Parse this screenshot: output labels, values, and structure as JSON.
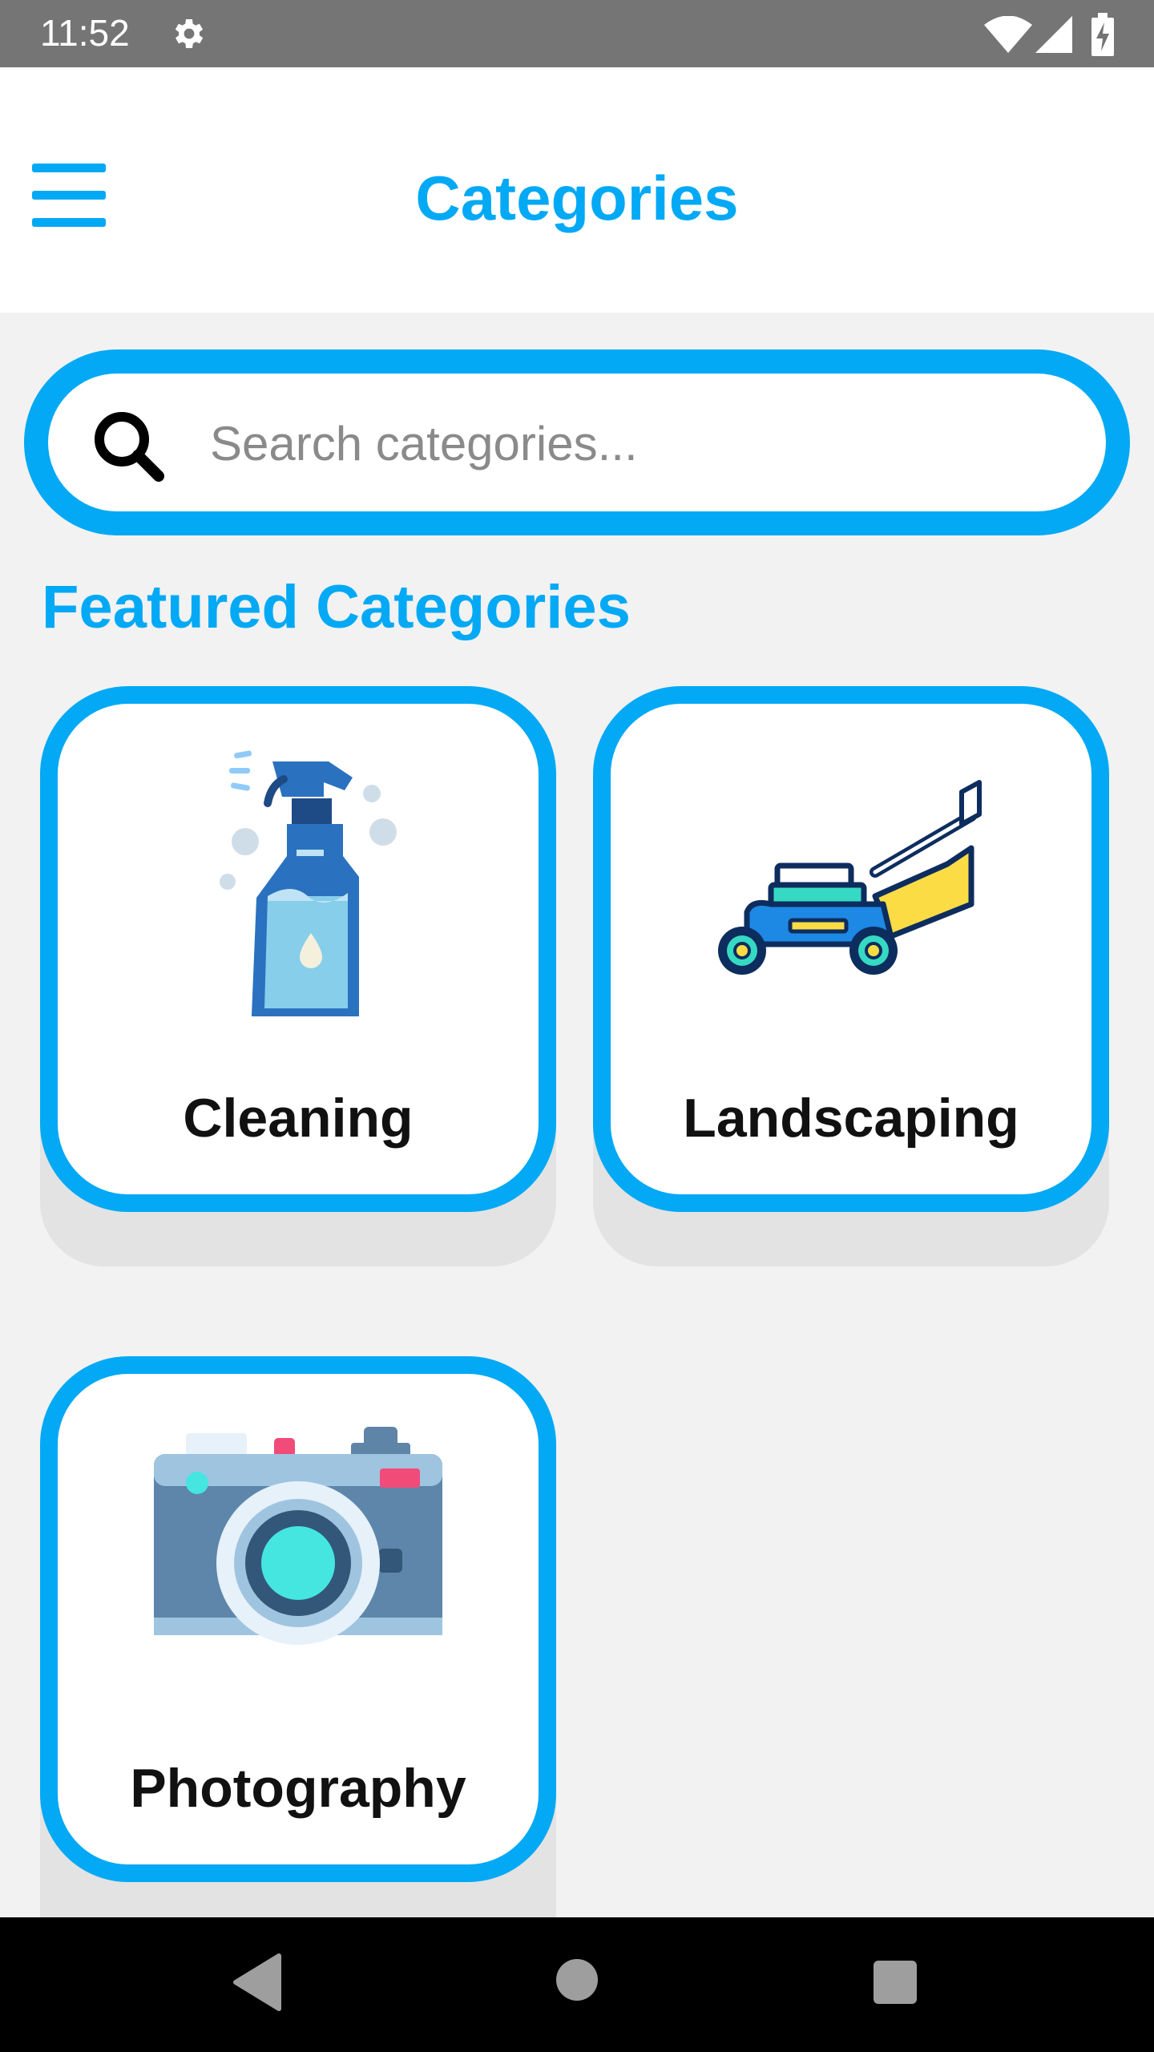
{
  "status_bar": {
    "time": "11:52",
    "icons": [
      "gear-icon",
      "wifi-icon",
      "cell-signal-icon",
      "battery-charging-icon"
    ]
  },
  "app_bar": {
    "title": "Categories",
    "menu_icon": "hamburger-menu-icon"
  },
  "search": {
    "placeholder": "Search categories...",
    "value": "",
    "icon": "search-icon"
  },
  "featured": {
    "heading": "Featured Categories",
    "categories": [
      {
        "label": "Cleaning",
        "icon": "spray-bottle-icon"
      },
      {
        "label": "Landscaping",
        "icon": "lawn-mower-icon"
      },
      {
        "label": "Photography",
        "icon": "camera-icon"
      }
    ]
  },
  "nav_bar": {
    "buttons": [
      "back-icon",
      "home-icon",
      "recents-icon"
    ]
  },
  "colors": {
    "accent": "#03a9f4",
    "status_bar": "#757575",
    "background": "#f2f2f2",
    "nav_bar": "#000000"
  }
}
